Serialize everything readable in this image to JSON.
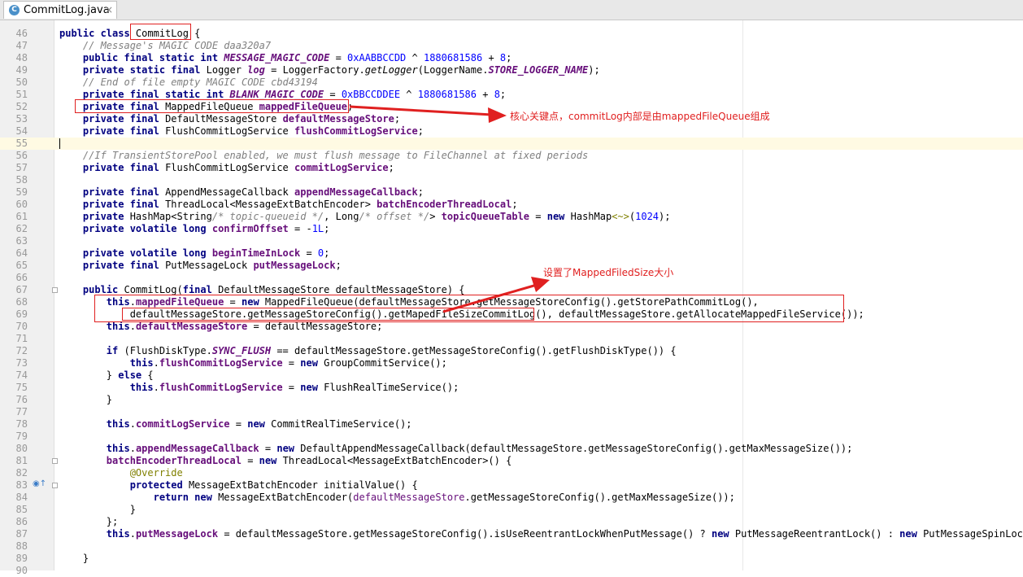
{
  "tab": {
    "icon_letter": "C",
    "title": "CommitLog.java",
    "close": "×"
  },
  "lines": [
    {
      "n": "46",
      "html": "<span class=\"kw\">public class </span>CommitLog {"
    },
    {
      "n": "47",
      "html": "    <span class=\"cm\">// Message's MAGIC CODE daa320a7</span>"
    },
    {
      "n": "48",
      "html": "    <span class=\"kw\">public final static int </span><span class=\"fdi\">MESSAGE_MAGIC_CODE</span> = <span class=\"num\">0xAABBCCDD</span> ^ <span class=\"num\">1880681586</span> + <span class=\"num\">8</span>;"
    },
    {
      "n": "49",
      "html": "    <span class=\"kw\">private static final </span>Logger <span class=\"fdi\">log</span> = LoggerFactory.<span class=\"it\">getLogger</span>(LoggerName.<span class=\"fdi\">STORE_LOGGER_NAME</span>);"
    },
    {
      "n": "50",
      "html": "    <span class=\"cm\">// End of file empty MAGIC CODE cbd43194</span>"
    },
    {
      "n": "51",
      "html": "    <span class=\"kw\">private final static int </span><span class=\"fdi\">BLANK_MAGIC_CODE</span> = <span class=\"num\">0xBBCCDDEE</span> ^ <span class=\"num\">1880681586</span> + <span class=\"num\">8</span>;"
    },
    {
      "n": "52",
      "html": "    <span class=\"kw\">private final </span>MappedFileQueue <span class=\"fd\">mappedFileQueue</span>;"
    },
    {
      "n": "53",
      "html": "    <span class=\"kw\">private final </span>DefaultMessageStore <span class=\"fd\">defaultMessageStore</span>;"
    },
    {
      "n": "54",
      "html": "    <span class=\"kw\">private final </span>FlushCommitLogService <span class=\"fd\">flushCommitLogService</span>;"
    },
    {
      "n": "55",
      "html": "",
      "caret": true
    },
    {
      "n": "56",
      "html": "    <span class=\"cm\">//If TransientStorePool enabled, we must flush message to FileChannel at fixed periods</span>"
    },
    {
      "n": "57",
      "html": "    <span class=\"kw\">private final </span>FlushCommitLogService <span class=\"fd\">commitLogService</span>;"
    },
    {
      "n": "58",
      "html": ""
    },
    {
      "n": "59",
      "html": "    <span class=\"kw\">private final </span>AppendMessageCallback <span class=\"fd\">appendMessageCallback</span>;"
    },
    {
      "n": "60",
      "html": "    <span class=\"kw\">private final </span>ThreadLocal&lt;MessageExtBatchEncoder&gt; <span class=\"fd\">batchEncoderThreadLocal</span>;"
    },
    {
      "n": "61",
      "html": "    <span class=\"kw\">private </span>HashMap&lt;String<span class=\"cm\">/* topic-queueid */</span>, Long<span class=\"cm\">/* offset */</span>&gt; <span class=\"fd\">topicQueueTable</span> = <span class=\"kw\">new </span>HashMap<span class=\"ann\">&lt;~&gt;</span>(<span class=\"num\">1024</span>);"
    },
    {
      "n": "62",
      "html": "    <span class=\"kw\">private volatile long </span><span class=\"fd\">confirmOffset</span> = -<span class=\"num\">1L</span>;"
    },
    {
      "n": "63",
      "html": ""
    },
    {
      "n": "64",
      "html": "    <span class=\"kw\">private volatile long </span><span class=\"fd\">beginTimeInLock</span> = <span class=\"num\">0</span>;"
    },
    {
      "n": "65",
      "html": "    <span class=\"kw\">private final </span>PutMessageLock <span class=\"fd\">putMessageLock</span>;"
    },
    {
      "n": "66",
      "html": ""
    },
    {
      "n": "67",
      "html": "    <span class=\"kw\">public </span>CommitLog(<span class=\"kw\">final </span>DefaultMessageStore defaultMessageStore) {",
      "fold": true
    },
    {
      "n": "68",
      "html": "        <span class=\"kw\">this</span>.<span class=\"fd\">mappedFileQueue</span> = <span class=\"kw\">new </span>MappedFileQueue(defaultMessageStore.getMessageStoreConfig().getStorePathCommitLog(),"
    },
    {
      "n": "69",
      "html": "            defaultMessageStore.getMessageStoreConfig().getMapedFileSizeCommitLog(), defaultMessageStore.getAllocateMappedFileService());"
    },
    {
      "n": "70",
      "html": "        <span class=\"kw\">this</span>.<span class=\"fd\">defaultMessageStore</span> = defaultMessageStore;"
    },
    {
      "n": "71",
      "html": ""
    },
    {
      "n": "72",
      "html": "        <span class=\"kw\">if </span>(FlushDiskType.<span class=\"fdi\">SYNC_FLUSH</span> == defaultMessageStore.getMessageStoreConfig().getFlushDiskType()) {"
    },
    {
      "n": "73",
      "html": "            <span class=\"kw\">this</span>.<span class=\"fd\">flushCommitLogService</span> = <span class=\"kw\">new </span>GroupCommitService();"
    },
    {
      "n": "74",
      "html": "        } <span class=\"kw\">else </span>{"
    },
    {
      "n": "75",
      "html": "            <span class=\"kw\">this</span>.<span class=\"fd\">flushCommitLogService</span> = <span class=\"kw\">new </span>FlushRealTimeService();"
    },
    {
      "n": "76",
      "html": "        }"
    },
    {
      "n": "77",
      "html": ""
    },
    {
      "n": "78",
      "html": "        <span class=\"kw\">this</span>.<span class=\"fd\">commitLogService</span> = <span class=\"kw\">new </span>CommitRealTimeService();"
    },
    {
      "n": "79",
      "html": ""
    },
    {
      "n": "80",
      "html": "        <span class=\"kw\">this</span>.<span class=\"fd\">appendMessageCallback</span> = <span class=\"kw\">new </span>DefaultAppendMessageCallback(defaultMessageStore.getMessageStoreConfig().getMaxMessageSize());"
    },
    {
      "n": "81",
      "html": "        <span class=\"fd\">batchEncoderThreadLocal</span> = <span class=\"kw\">new </span>ThreadLocal&lt;MessageExtBatchEncoder&gt;() {",
      "fold": true
    },
    {
      "n": "82",
      "html": "            <span class=\"ann\">@Override</span>"
    },
    {
      "n": "83",
      "html": "            <span class=\"kw\">protected </span>MessageExtBatchEncoder initialValue() {",
      "gicon": "◉↑",
      "fold": true
    },
    {
      "n": "84",
      "html": "                <span class=\"kw\">return new </span>MessageExtBatchEncoder(<span class=\"fd\" style=\"font-weight:normal;color:#660e7a\">defaultMessageStore</span>.getMessageStoreConfig().getMaxMessageSize());"
    },
    {
      "n": "85",
      "html": "            }"
    },
    {
      "n": "86",
      "html": "        };"
    },
    {
      "n": "87",
      "html": "        <span class=\"kw\">this</span>.<span class=\"fd\">putMessageLock</span> = defaultMessageStore.getMessageStoreConfig().isUseReentrantLockWhenPutMessage() ? <span class=\"kw\">new </span>PutMessageReentrantLock() : <span class=\"kw\">new </span>PutMessageSpinLock();"
    },
    {
      "n": "88",
      "html": ""
    },
    {
      "n": "89",
      "html": "    }"
    },
    {
      "n": "90",
      "html": ""
    }
  ],
  "annotations": {
    "callout_1": "核心关键点，commitLog内部是由mappedFileQueue组成",
    "callout_2": "设置了MappedFiledSize大小"
  }
}
